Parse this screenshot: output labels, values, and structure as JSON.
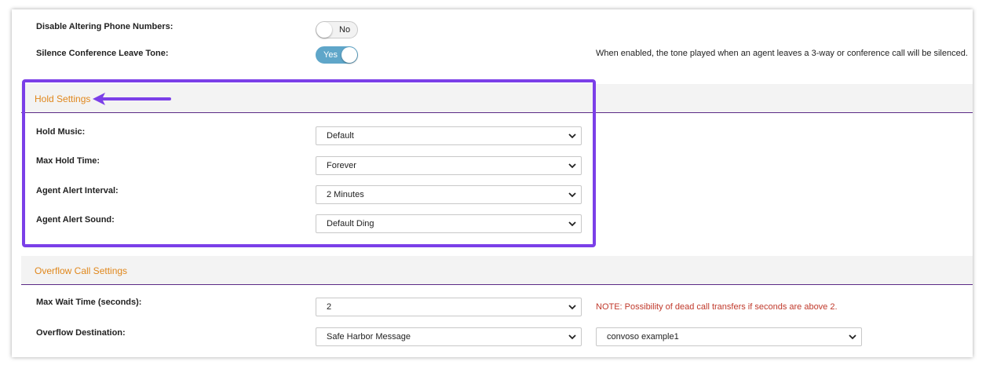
{
  "settings_top": [
    {
      "label": "Disable Altering Phone Numbers:",
      "toggle": "No",
      "state": "off"
    },
    {
      "label": "Silence Conference Leave Tone:",
      "toggle": "Yes",
      "state": "on",
      "help": "When enabled, the tone played when an agent leaves a 3-way or conference call will be silenced."
    }
  ],
  "hold_settings": {
    "title": "Hold Settings",
    "rows": [
      {
        "label": "Hold Music:",
        "value": "Default"
      },
      {
        "label": "Max Hold Time:",
        "value": "Forever"
      },
      {
        "label": "Agent Alert Interval:",
        "value": "2 Minutes"
      },
      {
        "label": "Agent Alert Sound:",
        "value": "Default Ding"
      }
    ]
  },
  "overflow_settings": {
    "title": "Overflow Call Settings",
    "max_wait": {
      "label": "Max Wait Time (seconds):",
      "value": "2",
      "note": "NOTE: Possibility of dead call transfers if seconds are above 2."
    },
    "destination": {
      "label": "Overflow Destination:",
      "value": "Safe Harbor Message",
      "target": "convoso example1"
    }
  },
  "colors": {
    "accent": "#e0871c",
    "divider": "#5b2a86",
    "toggle_on": "#5fa6c9",
    "note": "#c0392b",
    "highlight": "#7b3fe8"
  },
  "icons": {
    "select": "chevron-down-icon",
    "annotation": "arrow-left-icon"
  }
}
